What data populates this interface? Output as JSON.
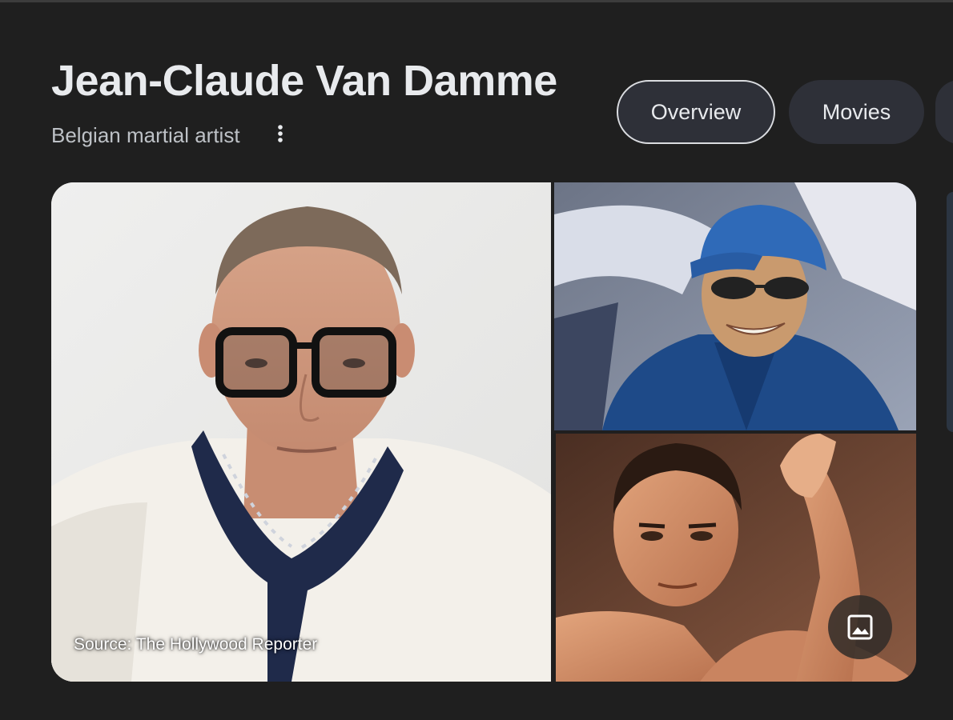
{
  "entity": {
    "name": "Jean-Claude Van Damme",
    "description": "Belgian martial artist"
  },
  "tabs": [
    {
      "label": "Overview",
      "selected": true
    },
    {
      "label": "Movies",
      "selected": false
    }
  ],
  "images": {
    "main_caption": "Source: The Hollywood Reporter"
  },
  "icons": {
    "more": "more-vert-icon",
    "images": "image-icon"
  },
  "colors": {
    "background": "#1f1f1f",
    "chip_background": "#2e3038",
    "chip_selected_border": "#dadce0",
    "title_text": "#e8eaed",
    "subtitle_text": "#bdc1c6"
  }
}
